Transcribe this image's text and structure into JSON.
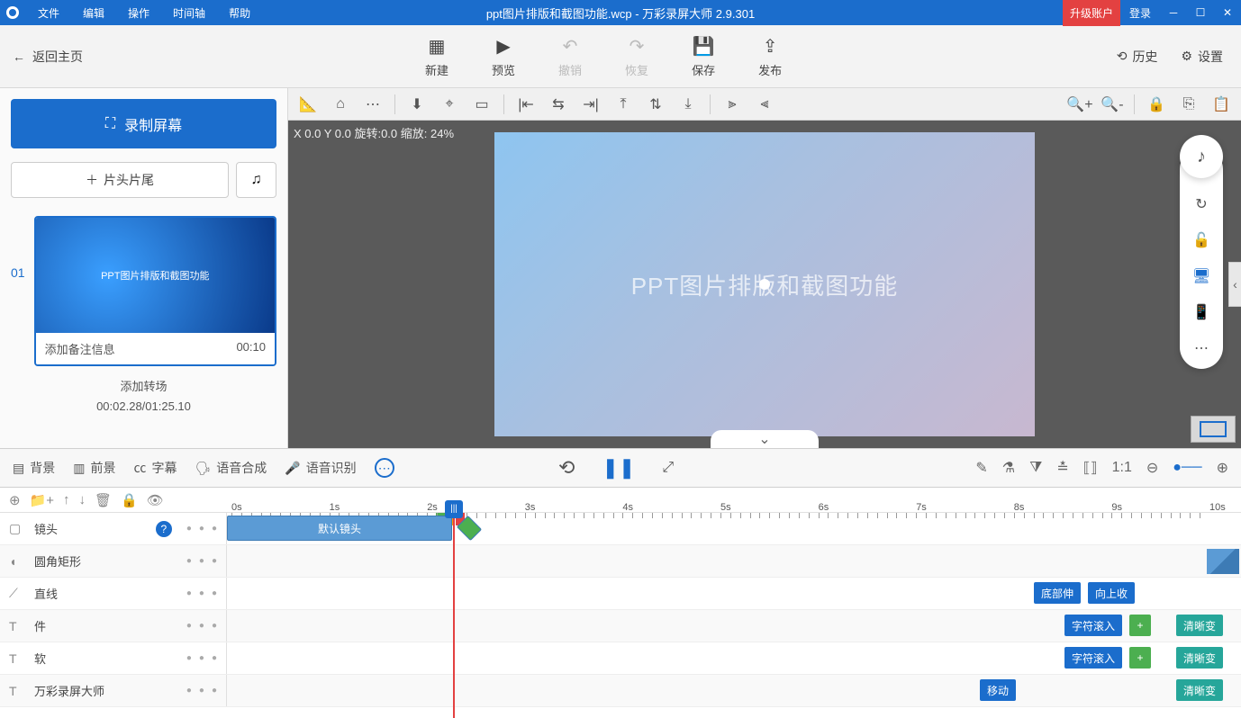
{
  "title": "ppt图片排版和截图功能.wcp - 万彩录屏大师 2.9.301",
  "menu": [
    "文件",
    "编辑",
    "操作",
    "时间轴",
    "帮助"
  ],
  "upgrade": "升级账户",
  "login": "登录",
  "back": "返回主页",
  "toolbar": {
    "new": "新建",
    "preview": "预览",
    "undo": "撤销",
    "redo": "恢复",
    "save": "保存",
    "publish": "发布",
    "history": "历史",
    "settings": "设置"
  },
  "left": {
    "record": "录制屏幕",
    "headtail": "片头片尾",
    "slides": [
      {
        "num": "01",
        "thumb_text": "PPT图片排版和截图功能",
        "note_placeholder": "添加备注信息",
        "duration": "00:10"
      }
    ],
    "add_transition": "添加转场",
    "time": "00:02.28/01:25.10"
  },
  "canvas": {
    "info": "X 0.0 Y 0.0 旋转:0.0 缩放: 24%",
    "stage_text": "PPT图片排版和截图功能"
  },
  "tl_tabs": {
    "bg": "背景",
    "fg": "前景",
    "subtitle": "字幕",
    "tts": "语音合成",
    "asr": "语音识别"
  },
  "ruler": [
    "0s",
    "1s",
    "2s",
    "3s",
    "4s",
    "5s",
    "6s",
    "7s",
    "8s",
    "9s",
    "10s"
  ],
  "tracks": {
    "camera": "镜头",
    "default_camera": "默认镜头",
    "roundrect": "圆角矩形",
    "line": "直线",
    "t1": "件",
    "t2": "软",
    "t3": "万彩录屏大师"
  },
  "effects": {
    "stretch_bottom": "底部伸",
    "collapse_up": "向上收",
    "char_roll": "字符滚入",
    "clear": "清晰变",
    "move": "移动"
  }
}
